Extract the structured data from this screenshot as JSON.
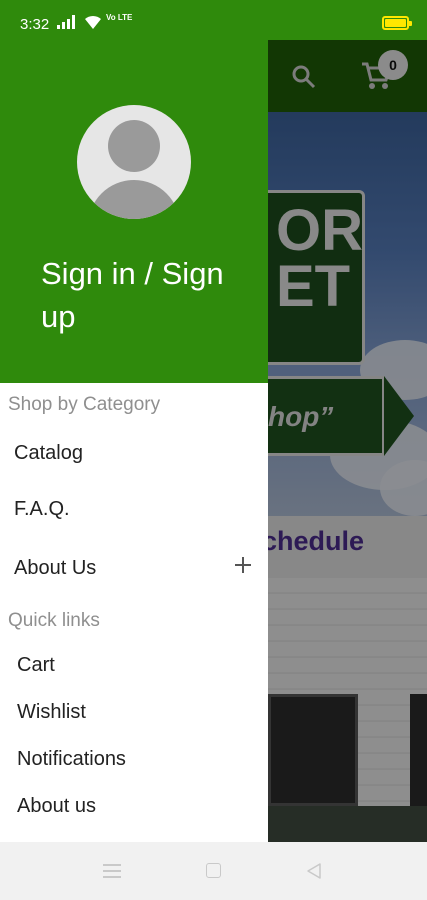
{
  "status_bar": {
    "time": "3:32",
    "network": "Vo LTE",
    "battery_color": "#ffe700"
  },
  "background_page": {
    "cart_count": "0",
    "banner_sign_text": "OR\nET",
    "banner_arrow_text": "hop”",
    "schedule_text": "chedule",
    "icons": [
      "search-icon",
      "cart-icon"
    ]
  },
  "drawer": {
    "sign_in_label": "Sign in / Sign up",
    "sections": {
      "shop_by_category": "Shop by Category",
      "quick_links": "Quick links"
    },
    "category_items": [
      {
        "label": "Catalog"
      },
      {
        "label": "F.A.Q."
      },
      {
        "label": "About Us",
        "expandable": true
      }
    ],
    "quick_links": [
      {
        "label": "Cart"
      },
      {
        "label": "Wishlist"
      },
      {
        "label": "Notifications"
      },
      {
        "label": "About us"
      }
    ],
    "header_color": "#2f8a0c"
  },
  "nav_bar": {
    "icons": [
      "menu-icon",
      "home-icon",
      "back-icon"
    ]
  }
}
